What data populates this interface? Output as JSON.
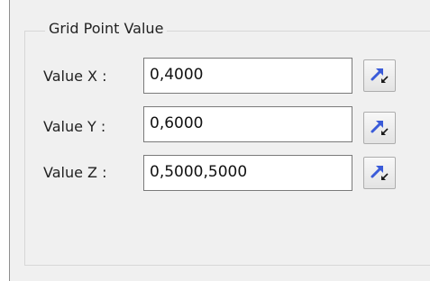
{
  "group": {
    "title": "Grid Point Value"
  },
  "fields": {
    "x": {
      "label": "Value X :",
      "value": "0,4000",
      "button_icon": "pick-arrow-icon"
    },
    "y": {
      "label": "Value Y :",
      "value": "0,6000",
      "button_icon": "pick-arrow-icon"
    },
    "z": {
      "label": "Value Z :",
      "value": "0,5000,5000",
      "button_icon": "pick-arrow-icon"
    }
  },
  "colors": {
    "icon_blue": "#3a5bd9",
    "icon_dark": "#1a1a1a"
  }
}
